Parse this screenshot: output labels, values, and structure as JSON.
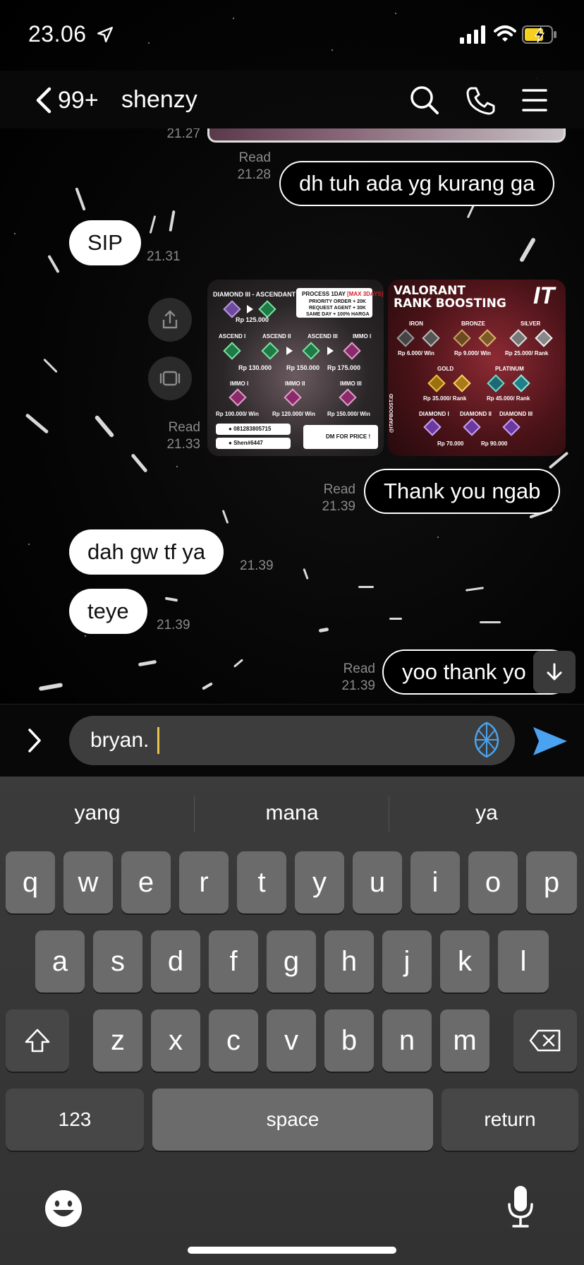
{
  "status_bar": {
    "time": "23.06"
  },
  "nav": {
    "back_count": "99+",
    "contact_name": "shenzy"
  },
  "messages": [
    {
      "id": "m0",
      "time": "21.27"
    },
    {
      "id": "m1",
      "text": "dh tuh ada yg kurang ga",
      "read": "Read",
      "time": "21.28"
    },
    {
      "id": "m2",
      "text": "SIP",
      "time": "21.31"
    },
    {
      "id": "m3",
      "read": "Read",
      "time": "21.33"
    },
    {
      "id": "m4",
      "text": "Thank you ngab",
      "read": "Read",
      "time": "21.39"
    },
    {
      "id": "m5",
      "text": "dah gw tf ya",
      "time": "21.39"
    },
    {
      "id": "m6",
      "text": "teye",
      "time": "21.39"
    },
    {
      "id": "m7",
      "text": "yoo thank yo",
      "read": "Read",
      "time": "21.39"
    }
  ],
  "promo_left": {
    "t1": "DIAMOND III - ASCENDANT I",
    "price1": "Rp 125.000",
    "process_title": "PROCESS 1DAY",
    "process_max": "[MAX 3DAYS]",
    "line1": "PRIORITY ORDER + 20K",
    "line2": "REQUEST AGENT + 30K",
    "line3": "SAME DAY + 100% HARGA",
    "asc1": "ASCEND I",
    "asc2": "ASCEND II",
    "asc3": "ASCEND III",
    "immo": "IMMO I",
    "p130": "Rp 130.000",
    "p150": "Rp 150.000",
    "p175": "Rp 175.000",
    "im1": "IMMO I",
    "im2": "IMMO II",
    "im3": "IMMO III",
    "w100": "Rp 100.000/ Win",
    "w120": "Rp 120.000/ Win",
    "w150": "Rp 150.000/ Win",
    "phone": "081283805715",
    "discord": "Shen#6447",
    "dm": "DM FOR PRICE !"
  },
  "promo_right": {
    "title1": "VALORANT",
    "title2": "RANK BOOSTING",
    "logo": "IT",
    "iron": "IRON",
    "bronze": "BRONZE",
    "silver": "SILVER",
    "p_iron": "Rp 6.000/ Win",
    "p_bronze": "Rp 9.000/ Win",
    "p_silver": "Rp 25.000/ Rank",
    "gold": "GOLD",
    "platinum": "PLATINUM",
    "p_gold": "Rp 35.000/ Rank",
    "p_plat": "Rp 45.000/ Rank",
    "d1": "DIAMOND I",
    "d2": "DIAMOND II",
    "d3": "DIAMOND III",
    "p_d1": "Rp 70.000",
    "p_d2": "Rp 90.000",
    "insta": "@ITAPBOOST.ID"
  },
  "input": {
    "value": "bryan."
  },
  "keyboard": {
    "suggestions": [
      "yang",
      "mana",
      "ya"
    ],
    "row1": [
      "q",
      "w",
      "e",
      "r",
      "t",
      "y",
      "u",
      "i",
      "o",
      "p"
    ],
    "row2": [
      "a",
      "s",
      "d",
      "f",
      "g",
      "h",
      "j",
      "k",
      "l"
    ],
    "row3": [
      "z",
      "x",
      "c",
      "v",
      "b",
      "n",
      "m"
    ],
    "numbers_label": "123",
    "space_label": "space",
    "return_label": "return"
  },
  "colors": {
    "accent_send": "#4aa3f0",
    "bubble_in": "#ffffff",
    "bubble_out_border": "#ffffff",
    "keyboard_bg": "#363636",
    "key": "#6b6b6b"
  },
  "icons": [
    "location-arrow-icon",
    "signal-icon",
    "wifi-icon",
    "battery-charging-icon",
    "chevron-left-icon",
    "search-icon",
    "phone-icon",
    "menu-icon",
    "share-icon",
    "forward-icon",
    "scroll-down-icon",
    "expand-icon",
    "sticker-icon",
    "send-icon",
    "shift-icon",
    "backspace-icon",
    "emoji-icon",
    "microphone-icon"
  ]
}
